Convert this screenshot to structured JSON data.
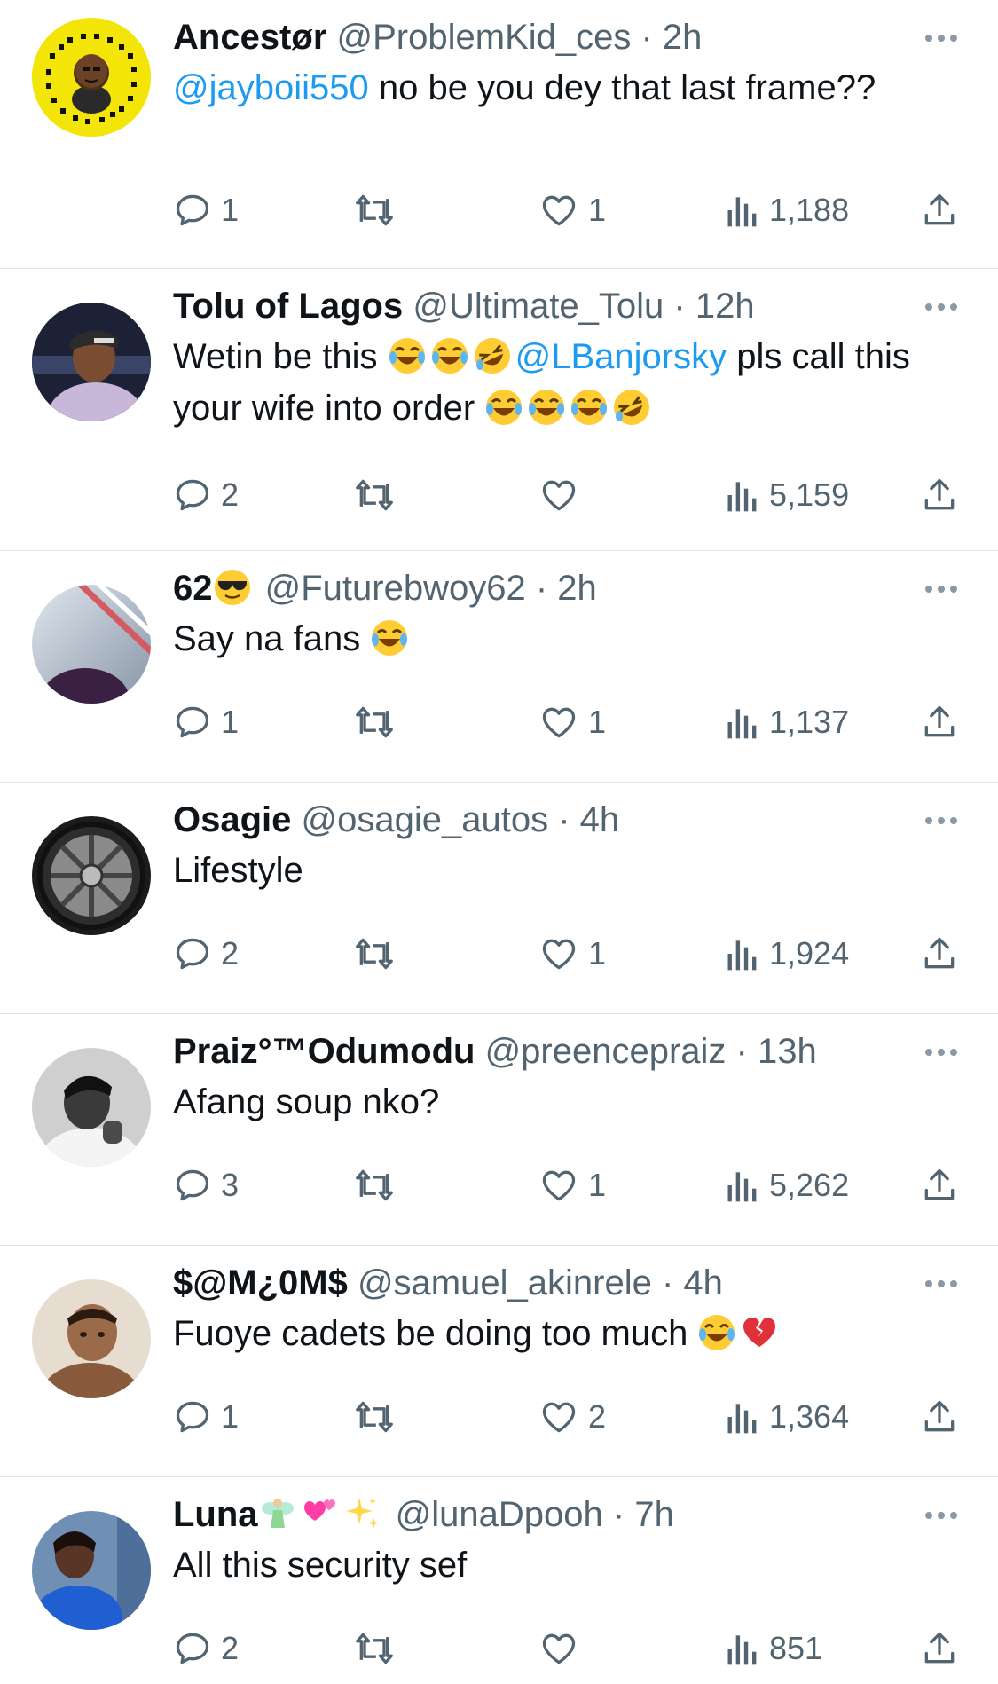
{
  "tweets": [
    {
      "name": "Ancestør",
      "handle": "@ProblemKid_ces",
      "time": "2h",
      "mention": "@jayboii550",
      "text": " no be you dey that last frame??",
      "replies": "1",
      "retweets": "",
      "likes": "1",
      "views": "1,188"
    },
    {
      "name": "Tolu of Lagos",
      "handle": "@Ultimate_Tolu",
      "time": "12h",
      "text_a": "Wetin be this ",
      "emoji_a": [
        "joy",
        "joy",
        "rofl"
      ],
      "mention": "@LBanjorsky",
      "text_b": " pls call this your wife into order ",
      "emoji_b": [
        "joy",
        "joy",
        "joy",
        "rofl"
      ],
      "replies": "2",
      "retweets": "",
      "likes": "",
      "views": "5,159"
    },
    {
      "name": "62",
      "name_emoji": "sunglasses",
      "handle": "@Futurebwoy62",
      "time": "2h",
      "text": "Say na fans ",
      "emoji": [
        "joy"
      ],
      "replies": "1",
      "retweets": "",
      "likes": "1",
      "views": "1,137"
    },
    {
      "name": "Osagie",
      "handle": "@osagie_autos",
      "time": "4h",
      "text": "Lifestyle",
      "replies": "2",
      "retweets": "",
      "likes": "1",
      "views": "1,924"
    },
    {
      "name": "Praiz°™Odumodu",
      "handle": "@preencepraiz",
      "time": "13h",
      "text": "Afang soup nko?",
      "replies": "3",
      "retweets": "",
      "likes": "1",
      "views": "5,262"
    },
    {
      "name": "$@M¿0M$",
      "handle": "@samuel_akinrele",
      "time": "4h",
      "text": "Fuoye cadets be doing too much ",
      "emoji": [
        "joy",
        "broken-heart"
      ],
      "replies": "1",
      "retweets": "",
      "likes": "2",
      "views": "1,364"
    },
    {
      "name": "Luna",
      "name_emoji": [
        "fairy",
        "two-hearts",
        "sparkles"
      ],
      "handle": "@lunaDpooh",
      "time": "7h",
      "text": "All this security sef",
      "replies": "2",
      "retweets": "",
      "likes": "",
      "views": "851"
    }
  ],
  "meta_sep": " · ",
  "colors": {
    "accent": "#1d9bf0",
    "muted": "#536471",
    "text": "#0f1419",
    "separator": "#dfe3e7"
  }
}
